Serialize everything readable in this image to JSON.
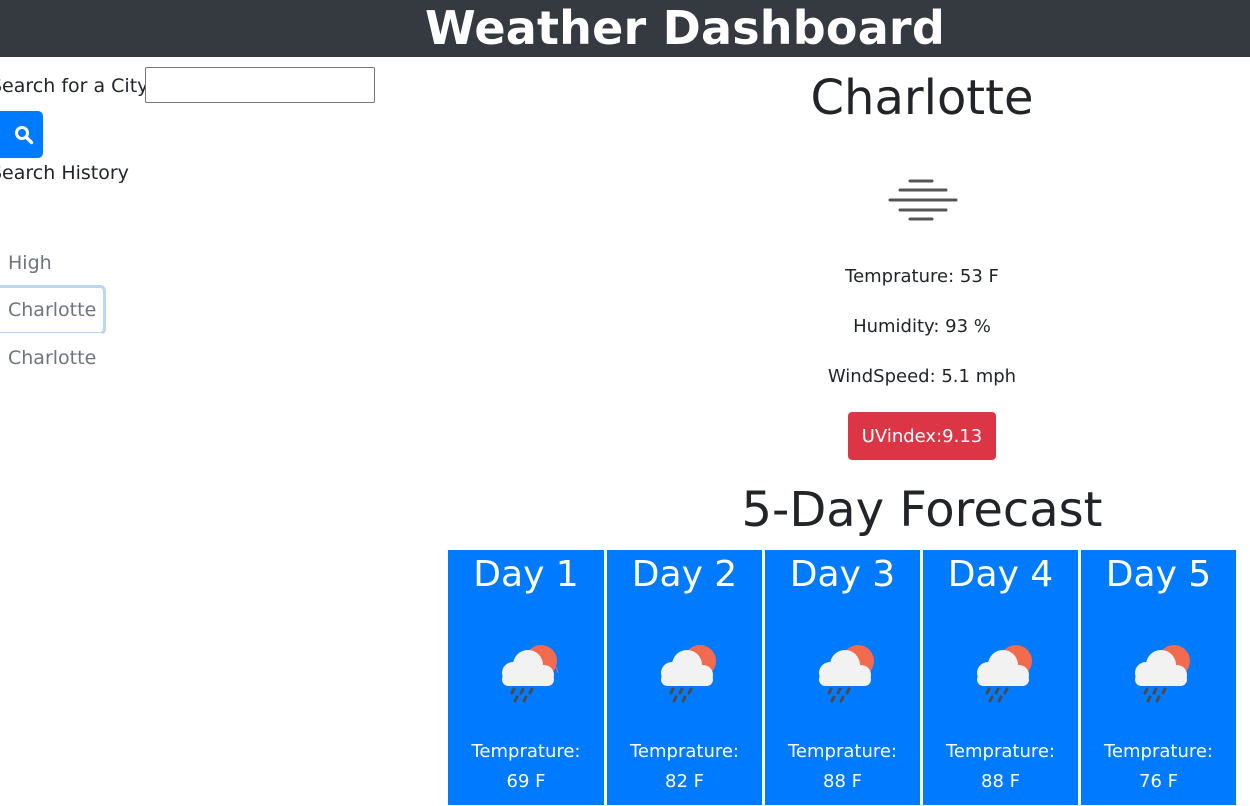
{
  "header": {
    "title": "Weather Dashboard"
  },
  "search": {
    "label": "Search for a City:",
    "input_value": "",
    "button_icon": "search-icon"
  },
  "history": {
    "title": "Search History",
    "items": [
      {
        "label": "High Point",
        "active": false
      },
      {
        "label": "Charlotte",
        "active": true
      },
      {
        "label": "Charlotte",
        "active": false
      }
    ]
  },
  "current": {
    "city": "Charlotte",
    "icon": "mist-icon",
    "temperature": "Temprature: 53 F",
    "humidity": "Humidity: 93 %",
    "wind": "WindSpeed: 5.1 mph",
    "uv": "UVindex:9.13"
  },
  "forecast": {
    "title": "5-Day Forecast",
    "days": [
      {
        "title": "Day 1",
        "icon": "rain-cloud-sun-icon",
        "temp_label": "Temprature:",
        "temp_value": "69 F"
      },
      {
        "title": "Day 2",
        "icon": "rain-cloud-sun-icon",
        "temp_label": "Temprature:",
        "temp_value": "82 F"
      },
      {
        "title": "Day 3",
        "icon": "rain-cloud-sun-icon",
        "temp_label": "Temprature:",
        "temp_value": "88 F"
      },
      {
        "title": "Day 4",
        "icon": "rain-cloud-sun-icon",
        "temp_label": "Temprature:",
        "temp_value": "88 F"
      },
      {
        "title": "Day 5",
        "icon": "rain-cloud-sun-icon",
        "temp_label": "Temprature:",
        "temp_value": "76 F"
      }
    ]
  },
  "colors": {
    "header_bg": "#343a40",
    "primary": "#007bff",
    "danger": "#dc3545",
    "muted_text": "#6c757d"
  }
}
